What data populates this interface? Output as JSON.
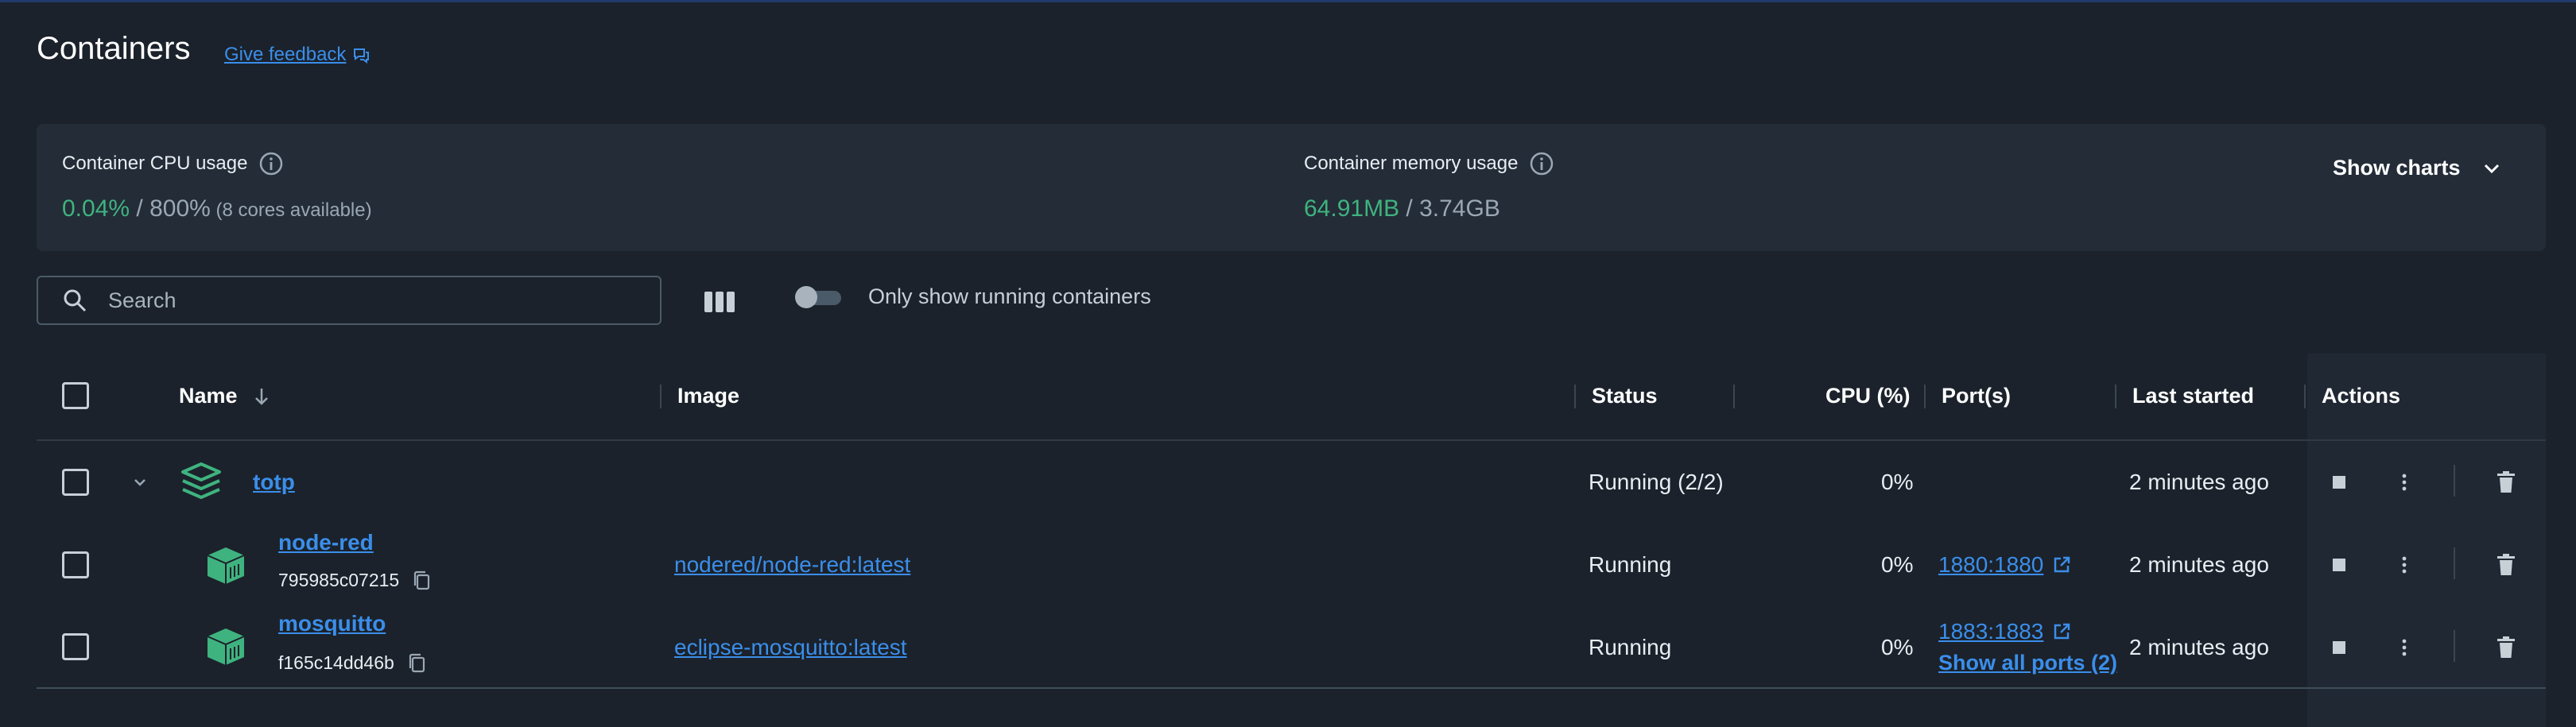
{
  "page": {
    "title": "Containers",
    "feedback": "Give feedback"
  },
  "stats": {
    "cpu_label": "Container CPU usage",
    "cpu_used": "0.04%",
    "cpu_sep": " / ",
    "cpu_total": "800%",
    "cpu_note": " (8 cores available)",
    "mem_label": "Container memory usage",
    "mem_used": "64.91MB",
    "mem_sep": " / ",
    "mem_total": "3.74GB",
    "show_charts": "Show charts"
  },
  "toolbar": {
    "search_placeholder": "Search",
    "only_running": "Only show running containers"
  },
  "table": {
    "headers": {
      "name": "Name",
      "image": "Image",
      "status": "Status",
      "cpu": "CPU (%)",
      "ports": "Port(s)",
      "last_started": "Last started",
      "actions": "Actions"
    },
    "rows": [
      {
        "name": "totp",
        "status": "Running (2/2)",
        "cpu": "0%",
        "last_started": "2 minutes ago"
      },
      {
        "name": "node-red",
        "id": "795985c07215",
        "image": "nodered/node-red:latest",
        "status": "Running",
        "cpu": "0%",
        "port": "1880:1880",
        "last_started": "2 minutes ago"
      },
      {
        "name": "mosquitto",
        "id": "f165c14dd46b",
        "image": "eclipse-mosquitto:latest",
        "status": "Running",
        "cpu": "0%",
        "port": "1883:1883",
        "show_all_ports": "Show all ports (2)",
        "last_started": "2 minutes ago"
      }
    ]
  },
  "colors": {
    "background": "#1b222b",
    "panel": "#232c37",
    "link": "#3b8eea",
    "green": "#3fb37f"
  },
  "icons": {
    "info": "info-icon",
    "chevron": "chevron-down-icon",
    "search": "search-icon",
    "columns": "columns-icon",
    "stack": "stack-icon",
    "container": "container-icon",
    "copy": "copy-icon",
    "external": "external-link-icon",
    "stop": "stop-icon",
    "more": "more-vertical-icon",
    "delete": "trash-icon"
  }
}
